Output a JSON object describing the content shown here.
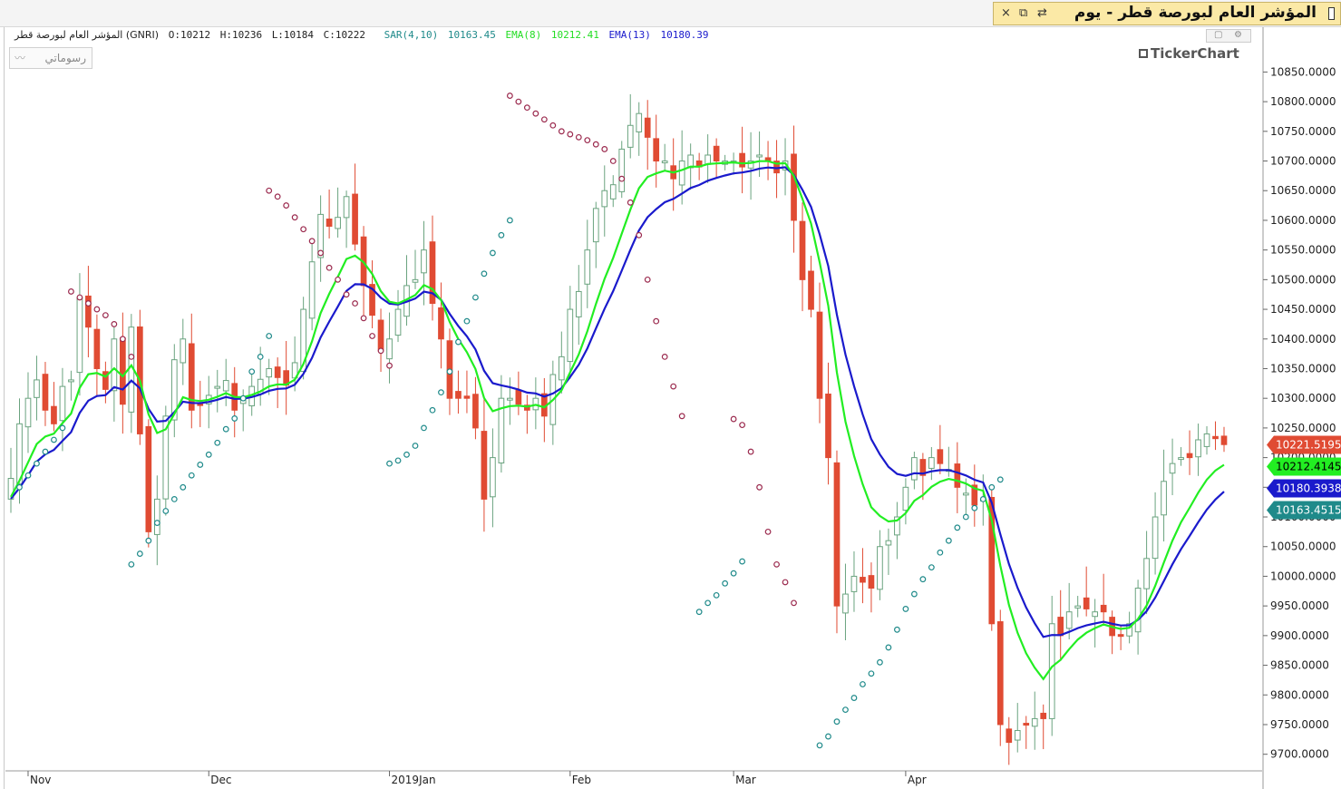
{
  "window": {
    "title": "المؤشر العام لبورصة قطر - يوم",
    "controls": [
      "×",
      "⧉",
      "⇄"
    ]
  },
  "legend": {
    "instrument": "المؤشر العام لبورصة قطر (GNRI)",
    "open": "O:10212",
    "high": "H:10236",
    "low": "L:10184",
    "close": "C:10222",
    "sar_label": "SAR(4,10)",
    "sar_value": "10163.45",
    "ema8_label": "EMA(8)",
    "ema8_value": "10212.41",
    "ema13_label": "EMA(13)",
    "ema13_value": "10180.39"
  },
  "drawings_button": "رسوماتي",
  "watermark": "TickerChart",
  "colors": {
    "up_candle": "#2e8b57",
    "down_candle": "#e04b33",
    "ema8": "#22ee22",
    "ema13": "#1a1acc",
    "sar_up": "#1f8a8a",
    "sar_down": "#9b2a4e",
    "price_tag": "#e04b33",
    "ema8_tag": "#22ee22",
    "ema13_tag": "#1a1acc",
    "sar_tag": "#1f8a8a"
  },
  "chart_data": {
    "type": "candlestick",
    "x_labels": [
      "Nov",
      "Dec",
      "2019Jan",
      "Feb",
      "Mar",
      "Apr"
    ],
    "x_label_index": [
      2,
      23,
      44,
      65,
      84,
      104
    ],
    "y_ticks": [
      9700,
      9750,
      9800,
      9850,
      9900,
      9950,
      10000,
      10050,
      10100,
      10150,
      10200,
      10250,
      10300,
      10350,
      10400,
      10450,
      10500,
      10550,
      10600,
      10650,
      10700,
      10750,
      10800,
      10850
    ],
    "y_tick_decimals": 4,
    "ylim": [
      9672,
      10898
    ],
    "grid": false,
    "closes": [
      10165,
      10257,
      10300,
      10331,
      10280,
      10257,
      10320,
      10331,
      10470,
      10420,
      10350,
      10315,
      10400,
      10290,
      10420,
      10240,
      10075,
      10130,
      10270,
      10365,
      10400,
      10280,
      10290,
      10305,
      10320,
      10330,
      10280,
      10300,
      10320,
      10332,
      10350,
      10335,
      10322,
      10360,
      10450,
      10530,
      10610,
      10590,
      10605,
      10640,
      10560,
      10490,
      10440,
      10380,
      10400,
      10450,
      10490,
      10500,
      10550,
      10460,
      10400,
      10300,
      10300,
      10300,
      10250,
      10130,
      10200,
      10300,
      10300,
      10290,
      10280,
      10300,
      10270,
      10340,
      10370,
      10450,
      10480,
      10550,
      10620,
      10650,
      10660,
      10720,
      10760,
      10780,
      10740,
      10700,
      10700,
      10670,
      10700,
      10710,
      10690,
      10710,
      10700,
      10700,
      10700,
      10690,
      10700,
      10710,
      10700,
      10680,
      10700,
      10600,
      10500,
      10450,
      10300,
      10200,
      9950,
      9970,
      10000,
      9990,
      9980,
      10050,
      10060,
      10100,
      10150,
      10200,
      10170,
      10200,
      10190,
      10180,
      10150,
      10140,
      10120,
      10130,
      9920,
      9750,
      9720,
      9740,
      9750,
      9760,
      9760,
      9920,
      9900,
      9940,
      9950,
      9945,
      9940,
      9940,
      9900,
      9900,
      9920,
      9980,
      10030,
      10100,
      10160,
      10190,
      10200,
      10200,
      10230,
      10240,
      10232,
      10222
    ],
    "sar_up_points": [
      [
        1,
        10150
      ],
      [
        2,
        10170
      ],
      [
        3,
        10190
      ],
      [
        4,
        10210
      ],
      [
        5,
        10230
      ],
      [
        6,
        10250
      ],
      [
        14,
        10020
      ],
      [
        15,
        10038
      ],
      [
        16,
        10060
      ],
      [
        17,
        10090
      ],
      [
        18,
        10110
      ],
      [
        19,
        10130
      ],
      [
        20,
        10150
      ],
      [
        21,
        10170
      ],
      [
        22,
        10188
      ],
      [
        23,
        10205
      ],
      [
        24,
        10225
      ],
      [
        25,
        10248
      ],
      [
        26,
        10266
      ],
      [
        27,
        10300
      ],
      [
        28,
        10345
      ],
      [
        29,
        10370
      ],
      [
        30,
        10405
      ],
      [
        44,
        10190
      ],
      [
        45,
        10195
      ],
      [
        46,
        10205
      ],
      [
        47,
        10220
      ],
      [
        48,
        10250
      ],
      [
        49,
        10280
      ],
      [
        50,
        10310
      ],
      [
        51,
        10345
      ],
      [
        52,
        10395
      ],
      [
        53,
        10430
      ],
      [
        54,
        10470
      ],
      [
        55,
        10510
      ],
      [
        56,
        10545
      ],
      [
        57,
        10575
      ],
      [
        58,
        10600
      ],
      [
        80,
        9940
      ],
      [
        81,
        9955
      ],
      [
        82,
        9968
      ],
      [
        83,
        9988
      ],
      [
        84,
        10005
      ],
      [
        85,
        10025
      ],
      [
        94,
        9715
      ],
      [
        95,
        9730
      ],
      [
        96,
        9755
      ],
      [
        97,
        9775
      ],
      [
        98,
        9795
      ],
      [
        99,
        9818
      ],
      [
        100,
        9836
      ],
      [
        101,
        9855
      ],
      [
        102,
        9880
      ],
      [
        103,
        9910
      ],
      [
        104,
        9945
      ],
      [
        105,
        9970
      ],
      [
        106,
        9995
      ],
      [
        107,
        10015
      ],
      [
        108,
        10040
      ],
      [
        109,
        10060
      ],
      [
        110,
        10082
      ],
      [
        111,
        10100
      ],
      [
        112,
        10115
      ],
      [
        113,
        10130
      ],
      [
        114,
        10150
      ],
      [
        115,
        10163
      ]
    ],
    "sar_down_points": [
      [
        7,
        10480
      ],
      [
        8,
        10470
      ],
      [
        9,
        10460
      ],
      [
        10,
        10450
      ],
      [
        11,
        10440
      ],
      [
        12,
        10425
      ],
      [
        13,
        10400
      ],
      [
        14,
        10370
      ],
      [
        30,
        10650
      ],
      [
        31,
        10640
      ],
      [
        32,
        10625
      ],
      [
        33,
        10605
      ],
      [
        34,
        10585
      ],
      [
        35,
        10565
      ],
      [
        36,
        10545
      ],
      [
        37,
        10520
      ],
      [
        38,
        10500
      ],
      [
        39,
        10475
      ],
      [
        40,
        10460
      ],
      [
        41,
        10435
      ],
      [
        42,
        10405
      ],
      [
        43,
        10380
      ],
      [
        44,
        10355
      ],
      [
        58,
        10810
      ],
      [
        59,
        10800
      ],
      [
        60,
        10790
      ],
      [
        61,
        10780
      ],
      [
        62,
        10770
      ],
      [
        63,
        10760
      ],
      [
        64,
        10750
      ],
      [
        65,
        10745
      ],
      [
        66,
        10740
      ],
      [
        67,
        10735
      ],
      [
        68,
        10728
      ],
      [
        69,
        10720
      ],
      [
        70,
        10700
      ],
      [
        71,
        10670
      ],
      [
        72,
        10630
      ],
      [
        73,
        10575
      ],
      [
        74,
        10500
      ],
      [
        75,
        10430
      ],
      [
        76,
        10370
      ],
      [
        77,
        10320
      ],
      [
        78,
        10270
      ],
      [
        84,
        10265
      ],
      [
        85,
        10255
      ],
      [
        86,
        10210
      ],
      [
        87,
        10150
      ],
      [
        88,
        10075
      ],
      [
        89,
        10020
      ],
      [
        90,
        9990
      ],
      [
        91,
        9955
      ]
    ],
    "series": [
      {
        "name": "EMA(8)",
        "value": "10212.41"
      },
      {
        "name": "EMA(13)",
        "value": "10180.39"
      },
      {
        "name": "SAR(4,10)",
        "value": "10163.45"
      }
    ],
    "last_value_tags": [
      {
        "label": "10221.5195",
        "value": 10221.5195,
        "color": "#e04b33"
      },
      {
        "label": "10212.4145",
        "value": 10212.4145,
        "color": "#22ee22"
      },
      {
        "label": "10180.3938",
        "value": 10180.3938,
        "color": "#1a1acc"
      },
      {
        "label": "10163.4515",
        "value": 10163.4515,
        "color": "#1f8a8a"
      }
    ]
  }
}
